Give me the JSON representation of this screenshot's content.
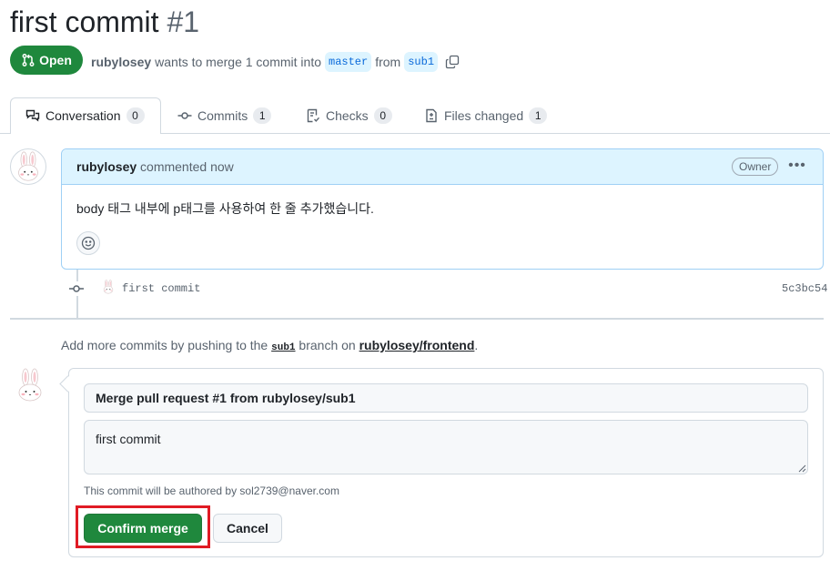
{
  "pull_request": {
    "title": "first commit",
    "number": "#1",
    "state": "Open",
    "author": "rubylosey",
    "merge_text": "wants to merge 1 commit into",
    "base_branch": "master",
    "from_text": "from",
    "head_branch": "sub1"
  },
  "tabs": [
    {
      "label": "Conversation",
      "count": "0",
      "icon": "comment-discussion-icon"
    },
    {
      "label": "Commits",
      "count": "1",
      "icon": "git-commit-icon"
    },
    {
      "label": "Checks",
      "count": "0",
      "icon": "checklist-icon"
    },
    {
      "label": "Files changed",
      "count": "1",
      "icon": "file-diff-icon"
    }
  ],
  "comment": {
    "author": "rubylosey",
    "time": "commented now",
    "badge": "Owner",
    "menu_icon": "kebab-horizontal-icon",
    "body": "body 태그 내부에 p태그를 사용하여 한 줄 추가했습니다.",
    "reaction_icon": "smiley-icon"
  },
  "commit": {
    "message": "first commit",
    "sha": "5c3bc54"
  },
  "push_hint": {
    "prefix": "Add more commits by pushing to the",
    "branch": "sub1",
    "middle": "branch on",
    "repo": "rubylosey/frontend",
    "suffix": "."
  },
  "merge": {
    "title_value": "Merge pull request #1 from rubylosey/sub1",
    "body_value": "first commit",
    "author_note": "This commit will be authored by sol2739@naver.com",
    "confirm_label": "Confirm merge",
    "cancel_label": "Cancel"
  },
  "colors": {
    "accent_green": "#1f883d",
    "comment_header": "#ddf4ff",
    "highlight_red": "#e01b24"
  }
}
